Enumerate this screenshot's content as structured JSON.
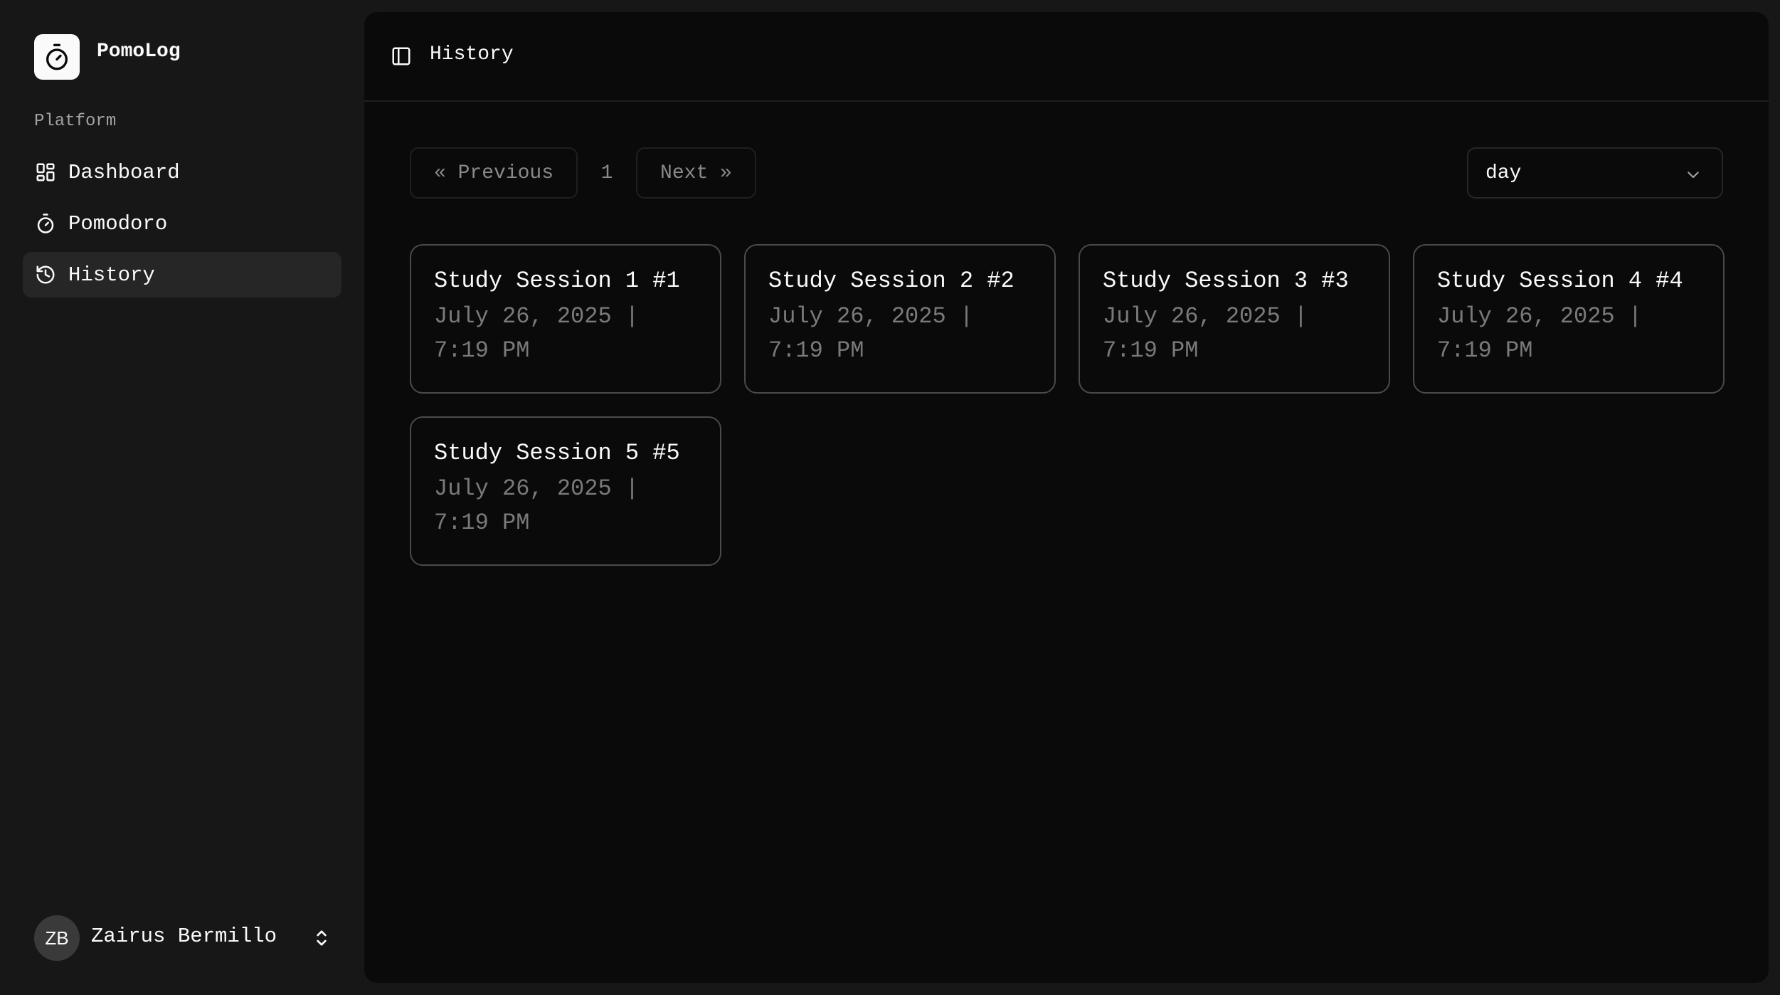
{
  "brand": {
    "name": "PomoLog",
    "logo_icon": "stopwatch-icon"
  },
  "sidebar": {
    "section_label": "Platform",
    "items": [
      {
        "label": "Dashboard",
        "icon": "grid-icon",
        "active": false
      },
      {
        "label": "Pomodoro",
        "icon": "timer-icon",
        "active": false
      },
      {
        "label": "History",
        "icon": "history-icon",
        "active": true
      }
    ]
  },
  "user": {
    "initials": "ZB",
    "name": "Zairus Bermillo"
  },
  "header": {
    "title": "History"
  },
  "pagination": {
    "previous_label": "« Previous",
    "page": "1",
    "next_label": "Next »"
  },
  "filter": {
    "selected": "day"
  },
  "sessions": [
    {
      "title": "Study Session 1 #1",
      "date": "July 26, 2025 | 7:19 PM"
    },
    {
      "title": "Study Session 2 #2",
      "date": "July 26, 2025 | 7:19 PM"
    },
    {
      "title": "Study Session 3 #3",
      "date": "July 26, 2025 | 7:19 PM"
    },
    {
      "title": "Study Session 4 #4",
      "date": "July 26, 2025 | 7:19 PM"
    },
    {
      "title": "Study Session 5 #5",
      "date": "July 26, 2025 | 7:19 PM"
    }
  ],
  "colors": {
    "background": "#171717",
    "main_background": "#0a0a0a",
    "active_item": "#262626",
    "card_border": "#4a4a4a",
    "muted_text": "#7a7a7a"
  }
}
